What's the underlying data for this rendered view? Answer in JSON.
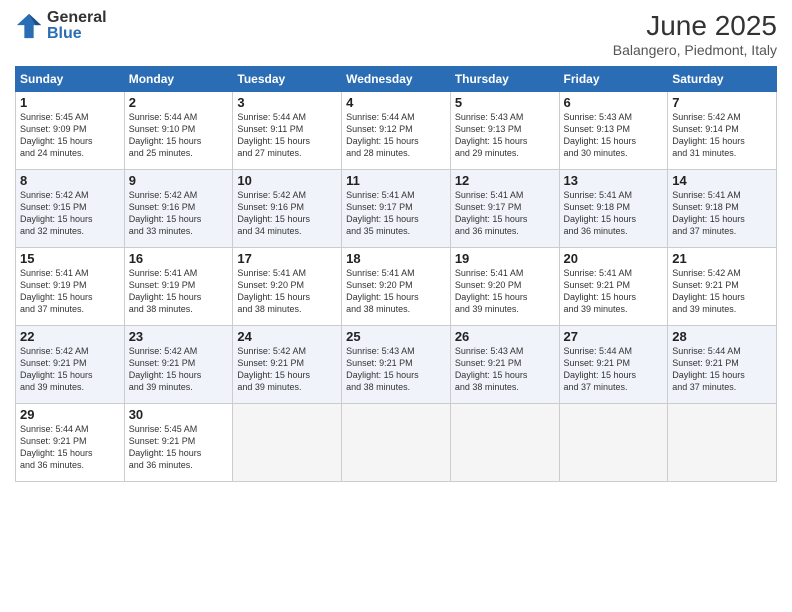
{
  "logo": {
    "general": "General",
    "blue": "Blue"
  },
  "title": "June 2025",
  "subtitle": "Balangero, Piedmont, Italy",
  "days_header": [
    "Sunday",
    "Monday",
    "Tuesday",
    "Wednesday",
    "Thursday",
    "Friday",
    "Saturday"
  ],
  "weeks": [
    [
      {
        "day": "1",
        "sunrise": "5:45 AM",
        "sunset": "9:09 PM",
        "daylight": "15 hours and 24 minutes."
      },
      {
        "day": "2",
        "sunrise": "5:44 AM",
        "sunset": "9:10 PM",
        "daylight": "15 hours and 25 minutes."
      },
      {
        "day": "3",
        "sunrise": "5:44 AM",
        "sunset": "9:11 PM",
        "daylight": "15 hours and 27 minutes."
      },
      {
        "day": "4",
        "sunrise": "5:44 AM",
        "sunset": "9:12 PM",
        "daylight": "15 hours and 28 minutes."
      },
      {
        "day": "5",
        "sunrise": "5:43 AM",
        "sunset": "9:13 PM",
        "daylight": "15 hours and 29 minutes."
      },
      {
        "day": "6",
        "sunrise": "5:43 AM",
        "sunset": "9:13 PM",
        "daylight": "15 hours and 30 minutes."
      },
      {
        "day": "7",
        "sunrise": "5:42 AM",
        "sunset": "9:14 PM",
        "daylight": "15 hours and 31 minutes."
      }
    ],
    [
      {
        "day": "8",
        "sunrise": "5:42 AM",
        "sunset": "9:15 PM",
        "daylight": "15 hours and 32 minutes."
      },
      {
        "day": "9",
        "sunrise": "5:42 AM",
        "sunset": "9:16 PM",
        "daylight": "15 hours and 33 minutes."
      },
      {
        "day": "10",
        "sunrise": "5:42 AM",
        "sunset": "9:16 PM",
        "daylight": "15 hours and 34 minutes."
      },
      {
        "day": "11",
        "sunrise": "5:41 AM",
        "sunset": "9:17 PM",
        "daylight": "15 hours and 35 minutes."
      },
      {
        "day": "12",
        "sunrise": "5:41 AM",
        "sunset": "9:17 PM",
        "daylight": "15 hours and 36 minutes."
      },
      {
        "day": "13",
        "sunrise": "5:41 AM",
        "sunset": "9:18 PM",
        "daylight": "15 hours and 36 minutes."
      },
      {
        "day": "14",
        "sunrise": "5:41 AM",
        "sunset": "9:18 PM",
        "daylight": "15 hours and 37 minutes."
      }
    ],
    [
      {
        "day": "15",
        "sunrise": "5:41 AM",
        "sunset": "9:19 PM",
        "daylight": "15 hours and 37 minutes."
      },
      {
        "day": "16",
        "sunrise": "5:41 AM",
        "sunset": "9:19 PM",
        "daylight": "15 hours and 38 minutes."
      },
      {
        "day": "17",
        "sunrise": "5:41 AM",
        "sunset": "9:20 PM",
        "daylight": "15 hours and 38 minutes."
      },
      {
        "day": "18",
        "sunrise": "5:41 AM",
        "sunset": "9:20 PM",
        "daylight": "15 hours and 38 minutes."
      },
      {
        "day": "19",
        "sunrise": "5:41 AM",
        "sunset": "9:20 PM",
        "daylight": "15 hours and 39 minutes."
      },
      {
        "day": "20",
        "sunrise": "5:41 AM",
        "sunset": "9:21 PM",
        "daylight": "15 hours and 39 minutes."
      },
      {
        "day": "21",
        "sunrise": "5:42 AM",
        "sunset": "9:21 PM",
        "daylight": "15 hours and 39 minutes."
      }
    ],
    [
      {
        "day": "22",
        "sunrise": "5:42 AM",
        "sunset": "9:21 PM",
        "daylight": "15 hours and 39 minutes."
      },
      {
        "day": "23",
        "sunrise": "5:42 AM",
        "sunset": "9:21 PM",
        "daylight": "15 hours and 39 minutes."
      },
      {
        "day": "24",
        "sunrise": "5:42 AM",
        "sunset": "9:21 PM",
        "daylight": "15 hours and 39 minutes."
      },
      {
        "day": "25",
        "sunrise": "5:43 AM",
        "sunset": "9:21 PM",
        "daylight": "15 hours and 38 minutes."
      },
      {
        "day": "26",
        "sunrise": "5:43 AM",
        "sunset": "9:21 PM",
        "daylight": "15 hours and 38 minutes."
      },
      {
        "day": "27",
        "sunrise": "5:44 AM",
        "sunset": "9:21 PM",
        "daylight": "15 hours and 37 minutes."
      },
      {
        "day": "28",
        "sunrise": "5:44 AM",
        "sunset": "9:21 PM",
        "daylight": "15 hours and 37 minutes."
      }
    ],
    [
      {
        "day": "29",
        "sunrise": "5:44 AM",
        "sunset": "9:21 PM",
        "daylight": "15 hours and 36 minutes."
      },
      {
        "day": "30",
        "sunrise": "5:45 AM",
        "sunset": "9:21 PM",
        "daylight": "15 hours and 36 minutes."
      },
      null,
      null,
      null,
      null,
      null
    ]
  ]
}
